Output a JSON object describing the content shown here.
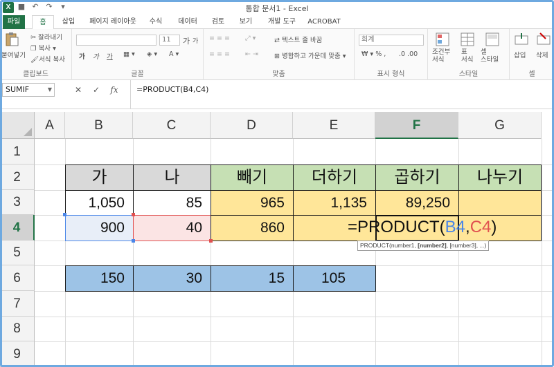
{
  "window": {
    "title": "통합 문서1 - Excel"
  },
  "tabs": [
    {
      "label": "파일",
      "kind": "file"
    },
    {
      "label": "홈",
      "kind": "active"
    },
    {
      "label": "삽입"
    },
    {
      "label": "페이지 레이아웃"
    },
    {
      "label": "수식"
    },
    {
      "label": "데이터"
    },
    {
      "label": "검토"
    },
    {
      "label": "보기"
    },
    {
      "label": "개발 도구"
    },
    {
      "label": "ACROBAT"
    }
  ],
  "ribbon": {
    "clipboard": {
      "paste": "붙여넣기",
      "cut": "잘라내기",
      "copy": "복사",
      "format_painter": "서식 복사",
      "label": "클립보드"
    },
    "font": {
      "size": "11",
      "grow": "가",
      "shrink": "가",
      "bold": "가",
      "italic": "가",
      "underline": "가",
      "label": "글꼴"
    },
    "alignment": {
      "wrap_text": "텍스트 줄 바꿈",
      "merge_center": "병합하고 가운데 맞춤",
      "label": "맞춤"
    },
    "number": {
      "format": "회계",
      "label": "표시 형식"
    },
    "styles": {
      "conditional": "조건부\n서식",
      "table": "표\n서식",
      "cell_styles": "셀\n스타일",
      "label": "스타일"
    },
    "cells": {
      "insert": "삽입",
      "delete": "삭제",
      "label": "셀"
    }
  },
  "formula_bar": {
    "name_box": "SUMIF",
    "cancel": "✕",
    "enter": "✓",
    "fx": "fx",
    "formula": "=PRODUCT(B4,C4)"
  },
  "columns": [
    "A",
    "B",
    "C",
    "D",
    "E",
    "F",
    "G"
  ],
  "rows": [
    "1",
    "2",
    "3",
    "4",
    "5",
    "6",
    "7",
    "8",
    "9"
  ],
  "selected_column": "F",
  "selected_row": "4",
  "cells": {
    "B2": "가",
    "C2": "나",
    "D2": "빼기",
    "E2": "더하기",
    "F2": "곱하기",
    "G2": "나누기",
    "B3": "1,050",
    "C3": "85",
    "D3": "965",
    "E3": "1,135",
    "F3": "89,250",
    "G3": "",
    "B4": "900",
    "C4": "40",
    "D4": "860",
    "B6": "150",
    "C6": "30",
    "D6": "15",
    "E6": "105"
  },
  "edit_formula": {
    "prefix": "=PRODUCT(",
    "ref1": "B4",
    "comma": ",",
    "ref2": "C4",
    "suffix": ")"
  },
  "tooltip": {
    "fn": "PRODUCT(number1, ",
    "bold": "[number2]",
    "rest": ", [number3], ...)"
  },
  "colors": {
    "excel_green": "#217346",
    "header_gray": "#d9d9d9",
    "header_green": "#c6e0b4",
    "row_yellow": "#ffe699",
    "row_blue": "#9dc3e6",
    "ref_blue": "#4a86e8",
    "ref_red": "#e05050"
  }
}
